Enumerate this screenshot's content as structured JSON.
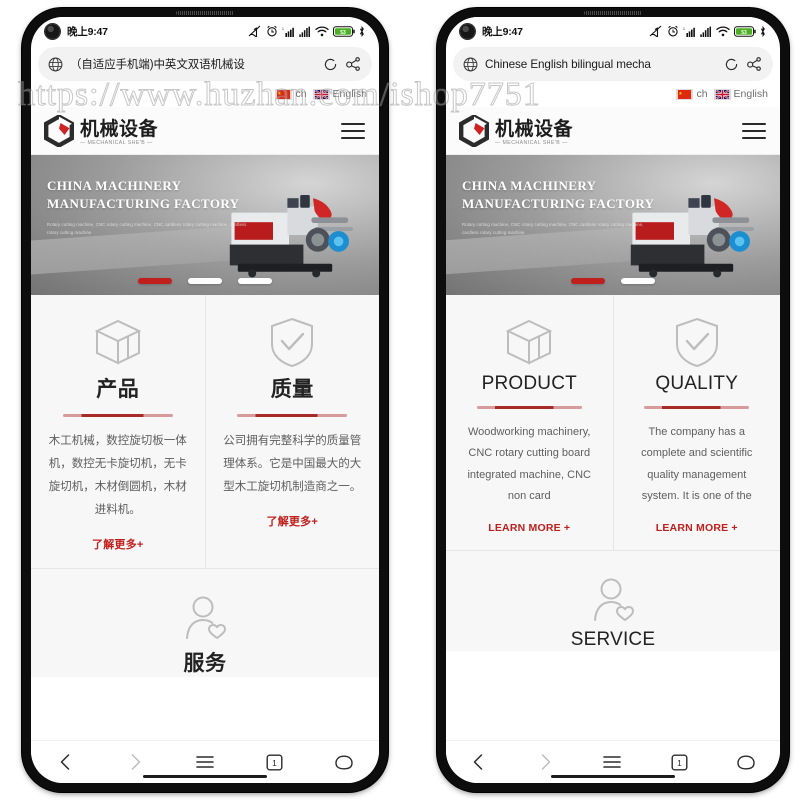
{
  "watermark": {
    "text": "https://www.huzhan.com/ishop7751"
  },
  "phones": {
    "left": {
      "status": {
        "time": "晚上9:47",
        "battery_level": "53"
      },
      "browser": {
        "page_title": "（自适应手机端)中英文双语机械设",
        "reload_icon": "reload-icon",
        "share_icon": "share-icon",
        "globe_icon": "globe-icon"
      },
      "site": {
        "lang": [
          {
            "code": "ch",
            "label": "ch",
            "flag": "cn"
          },
          {
            "code": "en",
            "label": "English",
            "flag": "uk"
          }
        ],
        "logo": {
          "cn": "机械设备",
          "en": "— MECHANICAL SHE'B —"
        },
        "banner": {
          "line1": "CHINA MACHINERY",
          "line2": "MANUFACTURING FACTORY",
          "sub": "Rotary cutting machine, CNC rotary cutting machine, CNC cardless rotary cutting machine, cardless rotary cutting machine",
          "slides": 3,
          "active_slide": 1
        },
        "cards": [
          {
            "icon": "cube-icon",
            "title": "产品",
            "body": "木工机械，数控旋切板一体机，数控无卡旋切机，无卡旋切机，木材倒圆机，木材进料机。",
            "cta": "了解更多+"
          },
          {
            "icon": "shield-check-icon",
            "title": "质量",
            "body": "公司拥有完整科学的质量管理体系。它是中国最大的大型木工旋切机制造商之一。",
            "cta": "了解更多+"
          }
        ],
        "service": {
          "icon": "user-heart-icon",
          "title": "服务"
        }
      },
      "nav": [
        "back-icon",
        "forward-icon",
        "menu-icon",
        "tabs-icon",
        "home-icon"
      ],
      "tab_count": "1"
    },
    "right": {
      "status": {
        "time": "晚上9:47",
        "battery_level": "53"
      },
      "browser": {
        "page_title": "Chinese English bilingual mecha",
        "reload_icon": "reload-icon",
        "share_icon": "share-icon",
        "globe_icon": "globe-icon"
      },
      "site": {
        "lang": [
          {
            "code": "ch",
            "label": "ch",
            "flag": "cn"
          },
          {
            "code": "en",
            "label": "English",
            "flag": "uk"
          }
        ],
        "logo": {
          "cn": "机械设备",
          "en": "— MECHANICAL SHE'B —"
        },
        "banner": {
          "line1": "CHINA MACHINERY",
          "line2": "MANUFACTURING FACTORY",
          "sub": "Rotary cutting machine, CNC rotary cutting machine, CNC cardless rotary cutting machine, cardless rotary cutting machine",
          "slides": 2,
          "active_slide": 1
        },
        "cards": [
          {
            "icon": "cube-icon",
            "title": "PRODUCT",
            "body": "Woodworking machinery, CNC rotary cutting board integrated machine, CNC non card",
            "cta": "LEARN MORE +"
          },
          {
            "icon": "shield-check-icon",
            "title": "QUALITY",
            "body": "The company has a complete and scientific quality management system. It is one of the",
            "cta": "LEARN MORE +"
          }
        ],
        "service": {
          "icon": "user-heart-icon",
          "title": "SERVICE"
        }
      },
      "nav": [
        "back-icon",
        "forward-icon",
        "menu-icon",
        "tabs-icon",
        "home-icon"
      ],
      "tab_count": "1"
    }
  },
  "colors": {
    "accent_red": "#c0201d",
    "rule_dark": "#a62a25",
    "banner_gray": "#9c9c9c"
  }
}
